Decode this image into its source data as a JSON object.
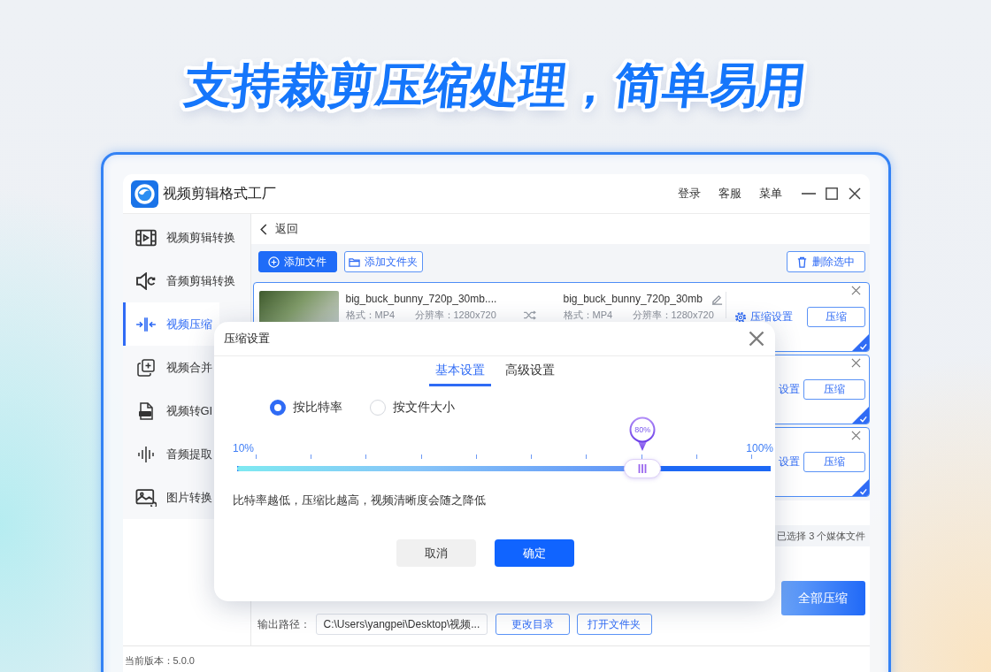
{
  "headline": "支持裁剪压缩处理，简单易用",
  "window": {
    "title": "视频剪辑格式工厂",
    "menu": [
      "登录",
      "客服",
      "菜单"
    ]
  },
  "sidebar": {
    "items": [
      {
        "label": "视频剪辑转换",
        "selected": false
      },
      {
        "label": "音频剪辑转换",
        "selected": false
      },
      {
        "label": "视频压缩",
        "selected": true
      },
      {
        "label": "视频合并",
        "selected": false
      },
      {
        "label": "视频转GI",
        "selected": false
      },
      {
        "label": "音频提取",
        "selected": false
      },
      {
        "label": "图片转换",
        "selected": false
      }
    ]
  },
  "back": "返回",
  "toolbar": {
    "add_file": "添加文件",
    "add_folder": "添加文件夹",
    "delete_selected": "删除选中"
  },
  "files": [
    {
      "name": "big_buck_bunny_720p_30mb....",
      "format": "格式：MP4",
      "resolution": "分辨率：1280x720",
      "output_name": "big_buck_bunny_720p_30mb",
      "output_format": "格式：MP4",
      "output_resolution": "分辨率：1280x720",
      "settings": "压缩设置",
      "action": "压缩",
      "selected": true
    },
    {
      "settings": "设置",
      "action": "压缩",
      "selected": true
    },
    {
      "settings": "设置",
      "action": "压缩",
      "selected": true
    }
  ],
  "selection_summary": "已选择 3 个媒体文件",
  "output": {
    "path_label": "输出路径：",
    "path": "C:\\Users\\yangpei\\Desktop\\视频...",
    "change_dir": "更改目录",
    "open_folder": "打开文件夹"
  },
  "compress_all": "全部压缩",
  "status_bar": "当前版本：5.0.0",
  "dialog": {
    "title": "压缩设置",
    "tabs": [
      {
        "label": "基本设置",
        "selected": true
      },
      {
        "label": "高级设置",
        "selected": false
      }
    ],
    "modes": [
      {
        "label": "按比特率",
        "selected": true
      },
      {
        "label": "按文件大小",
        "selected": false
      }
    ],
    "slider": {
      "min_label": "10%",
      "max_label": "100%",
      "reading": "80%",
      "level": 0.76
    },
    "hint": "比特率越低，压缩比越高，视频清晰度会随之降低",
    "buttons": [
      {
        "label": "取消",
        "kind": "secondary"
      },
      {
        "label": "确定",
        "kind": "primary"
      }
    ]
  }
}
